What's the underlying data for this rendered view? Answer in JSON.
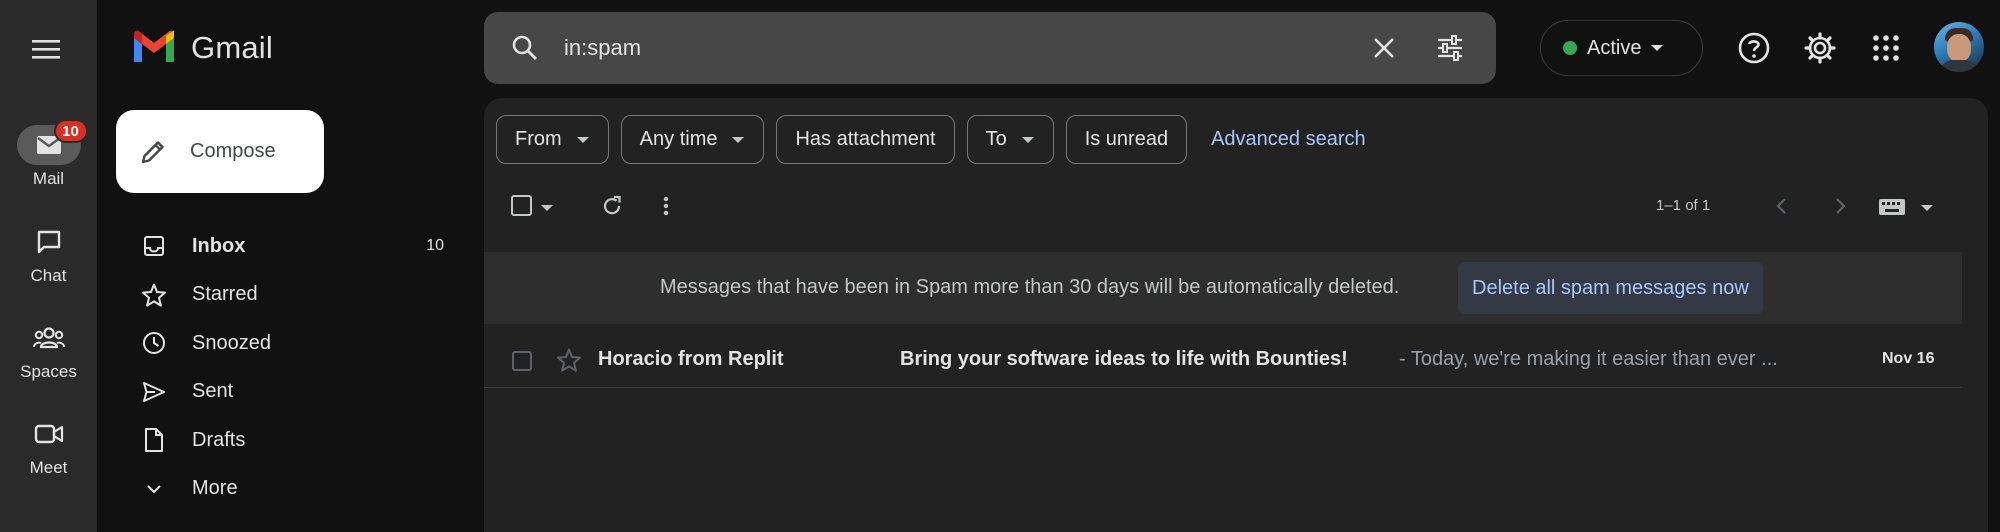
{
  "rail": {
    "items": [
      {
        "label": "Mail",
        "badge": "10"
      },
      {
        "label": "Chat"
      },
      {
        "label": "Spaces"
      },
      {
        "label": "Meet"
      }
    ]
  },
  "sidebar": {
    "app_name": "Gmail",
    "compose_label": "Compose",
    "nav": [
      {
        "label": "Inbox",
        "count": "10"
      },
      {
        "label": "Starred"
      },
      {
        "label": "Snoozed"
      },
      {
        "label": "Sent"
      },
      {
        "label": "Drafts"
      },
      {
        "label": "More"
      }
    ]
  },
  "search": {
    "query": "in:spam"
  },
  "status": {
    "label": "Active",
    "color": "#34a853"
  },
  "filters": {
    "chips": [
      "From",
      "Any time",
      "Has attachment",
      "To",
      "Is unread"
    ],
    "advanced_label": "Advanced search"
  },
  "toolbar": {
    "pagination": "1–1 of 1"
  },
  "notice": {
    "text": "Messages that have been in Spam more than 30 days will be automatically deleted.",
    "action_label": "Delete all spam messages now"
  },
  "messages": [
    {
      "sender": "Horacio from Replit",
      "subject": "Bring your software ideas to life with Bounties!",
      "snippet": "- Today, we're making it easier than ever ...",
      "date": "Nov 16"
    }
  ],
  "colors": {
    "accent_link": "#a8c7fa",
    "badge": "#d93025",
    "background": "#111111",
    "panel": "#222222"
  }
}
